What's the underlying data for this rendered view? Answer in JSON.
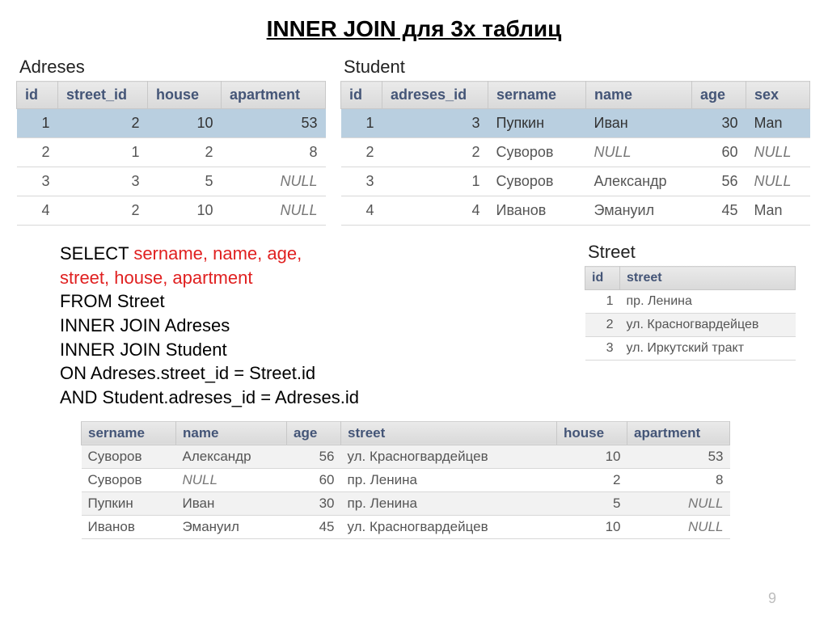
{
  "title": "INNER JOIN для 3х таблиц",
  "page_number": "9",
  "labels": {
    "adreses": "Adreses",
    "student": "Student",
    "street": "Street"
  },
  "adreses": {
    "headers": [
      "id",
      "street_id",
      "house",
      "apartment"
    ],
    "rows": [
      {
        "hl": true,
        "c": [
          "1",
          "2",
          "10",
          "53"
        ]
      },
      {
        "hl": false,
        "c": [
          "2",
          "1",
          "2",
          "8"
        ]
      },
      {
        "hl": false,
        "c": [
          "3",
          "3",
          "5",
          "NULL"
        ]
      },
      {
        "hl": false,
        "c": [
          "4",
          "2",
          "10",
          "NULL"
        ]
      }
    ]
  },
  "student": {
    "headers": [
      "id",
      "adreses_id",
      "sername",
      "name",
      "age",
      "sex"
    ],
    "rows": [
      {
        "hl": true,
        "c": [
          "1",
          "3",
          "Пупкин",
          "Иван",
          "30",
          "Man"
        ]
      },
      {
        "hl": false,
        "c": [
          "2",
          "2",
          "Суворов",
          "NULL",
          "60",
          "NULL"
        ]
      },
      {
        "hl": false,
        "c": [
          "3",
          "1",
          "Суворов",
          "Александр",
          "56",
          "NULL"
        ]
      },
      {
        "hl": false,
        "c": [
          "4",
          "4",
          "Иванов",
          "Эмануил",
          "45",
          "Man"
        ]
      }
    ]
  },
  "sql": {
    "l1a": "SELECT ",
    "l1b": "sername, name, age,",
    "l2": "street, house, apartment",
    "l3": "FROM Street",
    "l4": "INNER JOIN Adreses",
    "l5": "INNER JOIN Student",
    "l6": "ON Adreses.street_id = Street.id",
    "l7": "AND Student.adreses_id = Adreses.id"
  },
  "street": {
    "headers": [
      "id",
      "street"
    ],
    "rows": [
      {
        "alt": false,
        "c": [
          "1",
          "пр. Ленина"
        ]
      },
      {
        "alt": true,
        "c": [
          "2",
          "ул. Красногвардейцев"
        ]
      },
      {
        "alt": false,
        "c": [
          "3",
          "ул. Иркутский тракт"
        ]
      }
    ]
  },
  "result": {
    "headers": [
      "sername",
      "name",
      "age",
      "street",
      "house",
      "apartment"
    ],
    "rows": [
      {
        "alt": true,
        "c": [
          "Суворов",
          "Александр",
          "56",
          "ул. Красногвардейцев",
          "10",
          "53"
        ]
      },
      {
        "alt": false,
        "c": [
          "Суворов",
          "NULL",
          "60",
          "пр. Ленина",
          "2",
          "8"
        ]
      },
      {
        "alt": true,
        "c": [
          "Пупкин",
          "Иван",
          "30",
          "пр. Ленина",
          "5",
          "NULL"
        ]
      },
      {
        "alt": false,
        "c": [
          "Иванов",
          "Эмануил",
          "45",
          "ул. Красногвардейцев",
          "10",
          "NULL"
        ]
      }
    ]
  }
}
